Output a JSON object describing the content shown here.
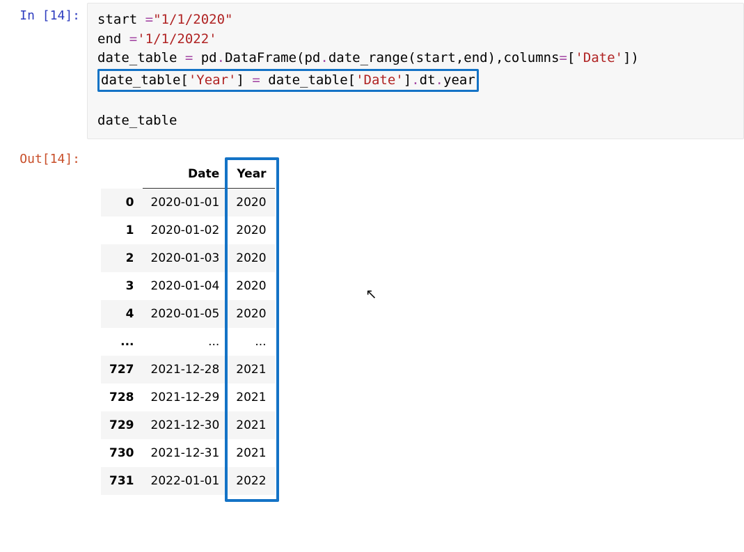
{
  "input_prompt": "In [14]:",
  "output_prompt": "Out[14]:",
  "code": {
    "l1a": "start ",
    "l1b": "=",
    "l1c": "\"1/1/2020\"",
    "l2a": "end ",
    "l2b": "=",
    "l2c": "'1/1/2022'",
    "l3a": "date_table ",
    "l3b": "=",
    "l3c": " pd",
    "l3d": ".",
    "l3e": "DataFrame(pd",
    "l3f": ".",
    "l3g": "date_range(start,end),columns",
    "l3h": "=",
    "l3i": "[",
    "l3j": "'Date'",
    "l3k": "])",
    "l4a": "date_table[",
    "l4b": "'Year'",
    "l4c": "] ",
    "l4d": "=",
    "l4e": " date_table[",
    "l4f": "'Date'",
    "l4g": "]",
    "l4h": ".",
    "l4i": "dt",
    "l4j": ".",
    "l4k": "year",
    "l6": "date_table"
  },
  "table": {
    "col_date": "Date",
    "col_year": "Year",
    "rows": [
      {
        "idx": "0",
        "date": "2020-01-01",
        "year": "2020"
      },
      {
        "idx": "1",
        "date": "2020-01-02",
        "year": "2020"
      },
      {
        "idx": "2",
        "date": "2020-01-03",
        "year": "2020"
      },
      {
        "idx": "3",
        "date": "2020-01-04",
        "year": "2020"
      },
      {
        "idx": "4",
        "date": "2020-01-05",
        "year": "2020"
      },
      {
        "idx": "...",
        "date": "...",
        "year": "..."
      },
      {
        "idx": "727",
        "date": "2021-12-28",
        "year": "2021"
      },
      {
        "idx": "728",
        "date": "2021-12-29",
        "year": "2021"
      },
      {
        "idx": "729",
        "date": "2021-12-30",
        "year": "2021"
      },
      {
        "idx": "730",
        "date": "2021-12-31",
        "year": "2021"
      },
      {
        "idx": "731",
        "date": "2022-01-01",
        "year": "2022"
      }
    ]
  },
  "highlight_color": "#1473c6"
}
